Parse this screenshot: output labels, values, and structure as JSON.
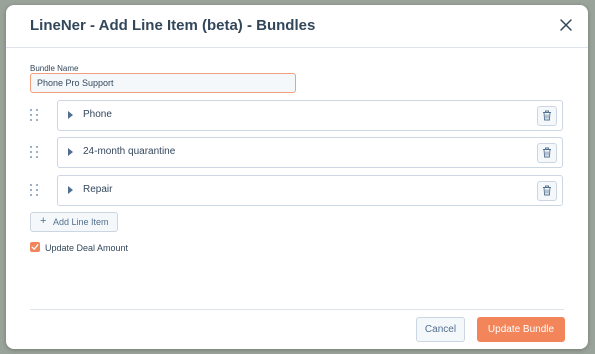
{
  "modal": {
    "title": "LineNer - Add Line Item (beta) - Bundles",
    "close_icon": "close-icon"
  },
  "form": {
    "bundle_name_label": "Bundle Name",
    "bundle_name_value": "Phone Pro Support"
  },
  "line_items": [
    {
      "label": "Phone"
    },
    {
      "label": "24-month quarantine"
    },
    {
      "label": "Repair"
    }
  ],
  "actions": {
    "add_line_item_label": "Add Line Item",
    "update_deal_amount_label": "Update Deal Amount",
    "update_deal_amount_checked": true,
    "cancel_label": "Cancel",
    "update_bundle_label": "Update Bundle"
  },
  "colors": {
    "accent": "#f2855a",
    "text": "#33475b",
    "border": "#cbd6e2"
  }
}
